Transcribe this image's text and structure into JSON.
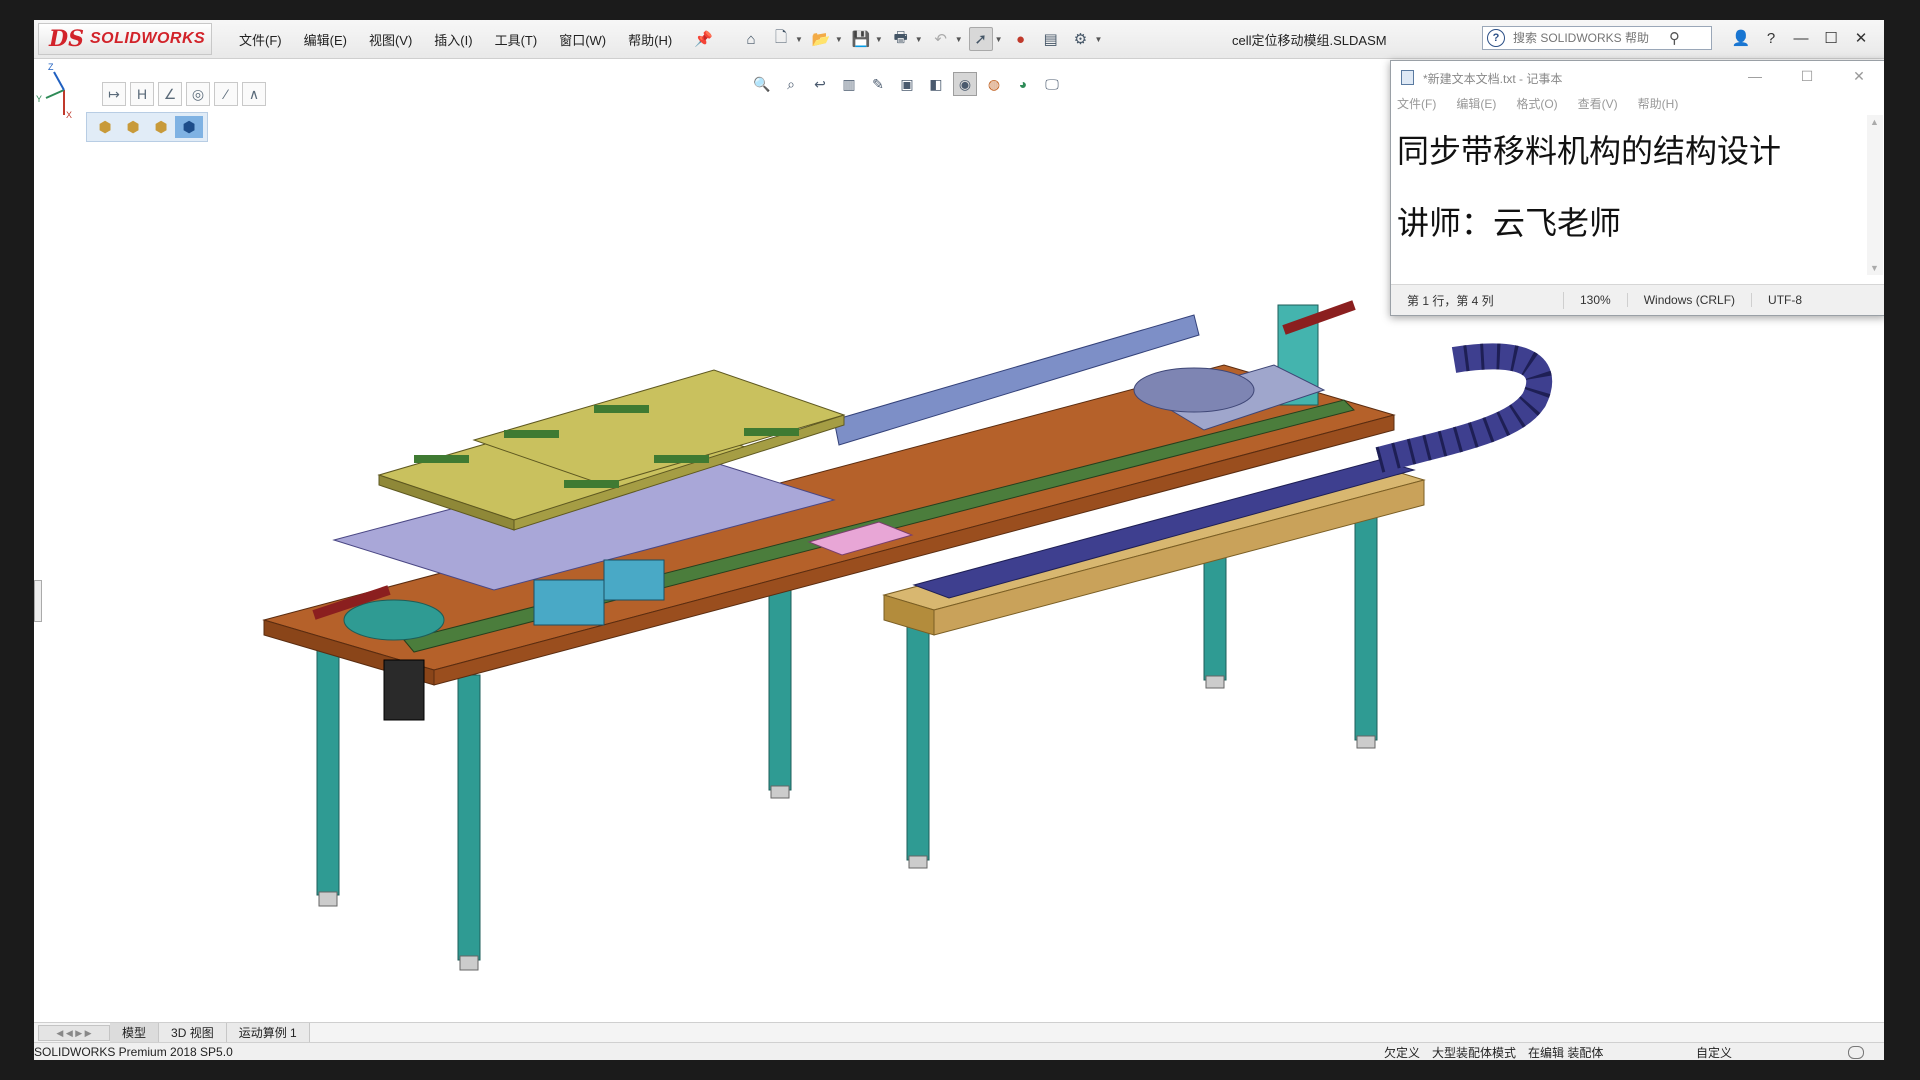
{
  "app": {
    "brand": "SOLIDWORKS",
    "document_title": "cell定位移动模组.SLDASM",
    "menu": [
      "文件(F)",
      "编辑(E)",
      "视图(V)",
      "插入(I)",
      "工具(T)",
      "窗口(W)",
      "帮助(H)"
    ],
    "help_search_placeholder": "搜索 SOLIDWORKS 帮助"
  },
  "toolbar_icons": [
    "home-icon",
    "new-document-icon",
    "open-icon",
    "save-icon",
    "print-icon",
    "undo-icon",
    "select-icon",
    "traffic-light-icon",
    "file-properties-icon",
    "options-icon"
  ],
  "heads_up_icons": [
    "zoom-to-fit-icon",
    "zoom-area-icon",
    "previous-view-icon",
    "section-view-icon",
    "dynamic-annotation-icon",
    "view-orientation-icon",
    "display-style-icon",
    "hide-show-icon",
    "edit-appearance-icon",
    "apply-scene-icon",
    "view-settings-icon"
  ],
  "notepad": {
    "title": "*新建文本文档.txt - 记事本",
    "menu": [
      "文件(F)",
      "编辑(E)",
      "格式(O)",
      "查看(V)",
      "帮助(H)"
    ],
    "lines": [
      "同步带移料机构的结构设计",
      "讲师：云飞老师"
    ],
    "status": {
      "position": "第 1 行，第 4 列",
      "zoom": "130%",
      "line_ending": "Windows (CRLF)",
      "encoding": "UTF-8"
    }
  },
  "tabs": [
    "模型",
    "3D 视图",
    "运动算例 1"
  ],
  "status_bar": {
    "product": "SOLIDWORKS Premium 2018 SP5.0",
    "right": [
      "欠定义",
      "大型装配体模式",
      "在编辑 装配体"
    ],
    "custom": "自定义"
  },
  "colors": {
    "brand_red": "#d2232a",
    "base_plate": "#b5612a",
    "legs": "#2f9b93",
    "top_plates": "#c9c15e",
    "drag_chain": "#3e3f8f",
    "rail_green": "#4b7d3c",
    "belt_beige": "#d8b770"
  }
}
